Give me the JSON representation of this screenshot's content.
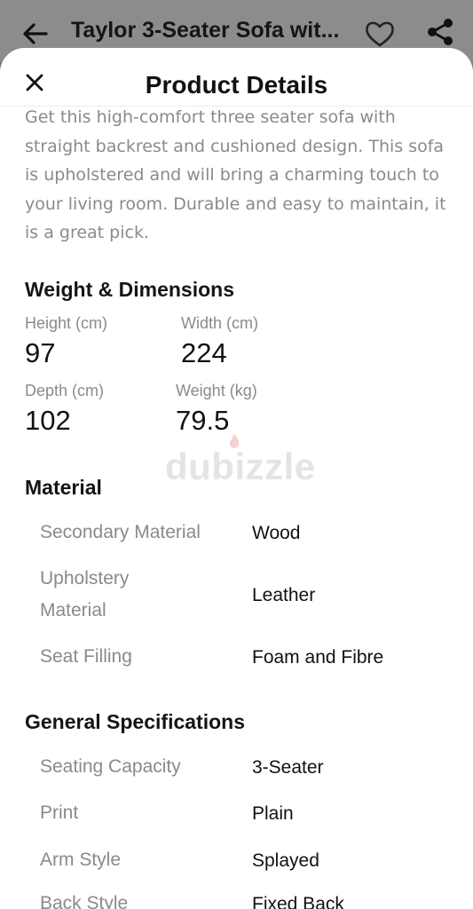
{
  "topbar": {
    "title": "Taylor 3-Seater Sofa wit..."
  },
  "sheet": {
    "title": "Product Details"
  },
  "description": "Get this high-comfort three seater sofa with straight backrest and cushioned design. This sofa is upholstered and will bring a charming touch to your living room. Durable and easy to maintain, it is a great pick.",
  "dimensions": {
    "title": "Weight & Dimensions",
    "height_label": "Height (cm)",
    "height": "97",
    "width_label": "Width (cm)",
    "width": "224",
    "depth_label": "Depth (cm)",
    "depth": "102",
    "weight_label": "Weight (kg)",
    "weight": "79.5"
  },
  "material": {
    "title": "Material",
    "rows": [
      {
        "label": "Secondary Material",
        "value": "Wood"
      },
      {
        "label": "Upholstery Material",
        "value": "Leather"
      },
      {
        "label": "Seat Filling",
        "value": "Foam and Fibre"
      }
    ]
  },
  "general": {
    "title": "General Specifications",
    "rows": [
      {
        "label": "Seating Capacity",
        "value": "3-Seater"
      },
      {
        "label": "Print",
        "value": "Plain"
      },
      {
        "label": "Arm Style",
        "value": "Splayed"
      },
      {
        "label": "Back Style",
        "value": "Fixed Back"
      }
    ]
  },
  "watermark": "dubizzle",
  "icons": {
    "back": "arrow-left-icon",
    "favorite": "heart-icon",
    "share": "share-icon",
    "close": "close-icon"
  },
  "colors": {
    "label_gray": "#8a8a8a",
    "text_dark": "#111111",
    "topbar_bg": "#8c8c8c"
  }
}
